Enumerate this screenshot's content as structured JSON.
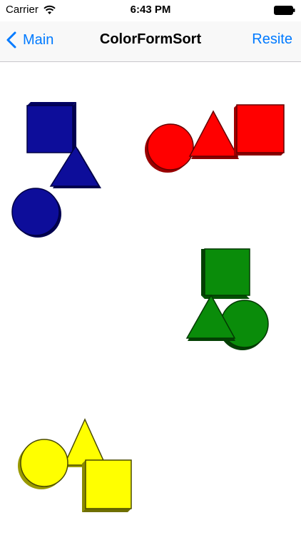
{
  "status_bar": {
    "carrier": "Carrier",
    "time": "6:43 PM",
    "wifi_icon": "wifi-icon",
    "battery_icon": "battery-icon"
  },
  "nav": {
    "back_label": "Main",
    "back_icon": "chevron-left-icon",
    "title": "ColorFormSort",
    "action_label": "Resite"
  },
  "shapes": {
    "colors": {
      "blue": "#0d0d9a",
      "red": "#ff0000",
      "green": "#0a8c0a",
      "yellow": "#ffff00",
      "accent": "#007aff"
    },
    "groups": [
      {
        "color": "blue",
        "items": [
          "square",
          "triangle",
          "circle"
        ]
      },
      {
        "color": "red",
        "items": [
          "circle",
          "triangle",
          "square"
        ]
      },
      {
        "color": "green",
        "items": [
          "square",
          "triangle",
          "circle"
        ]
      },
      {
        "color": "yellow",
        "items": [
          "triangle",
          "circle",
          "square"
        ]
      }
    ]
  }
}
